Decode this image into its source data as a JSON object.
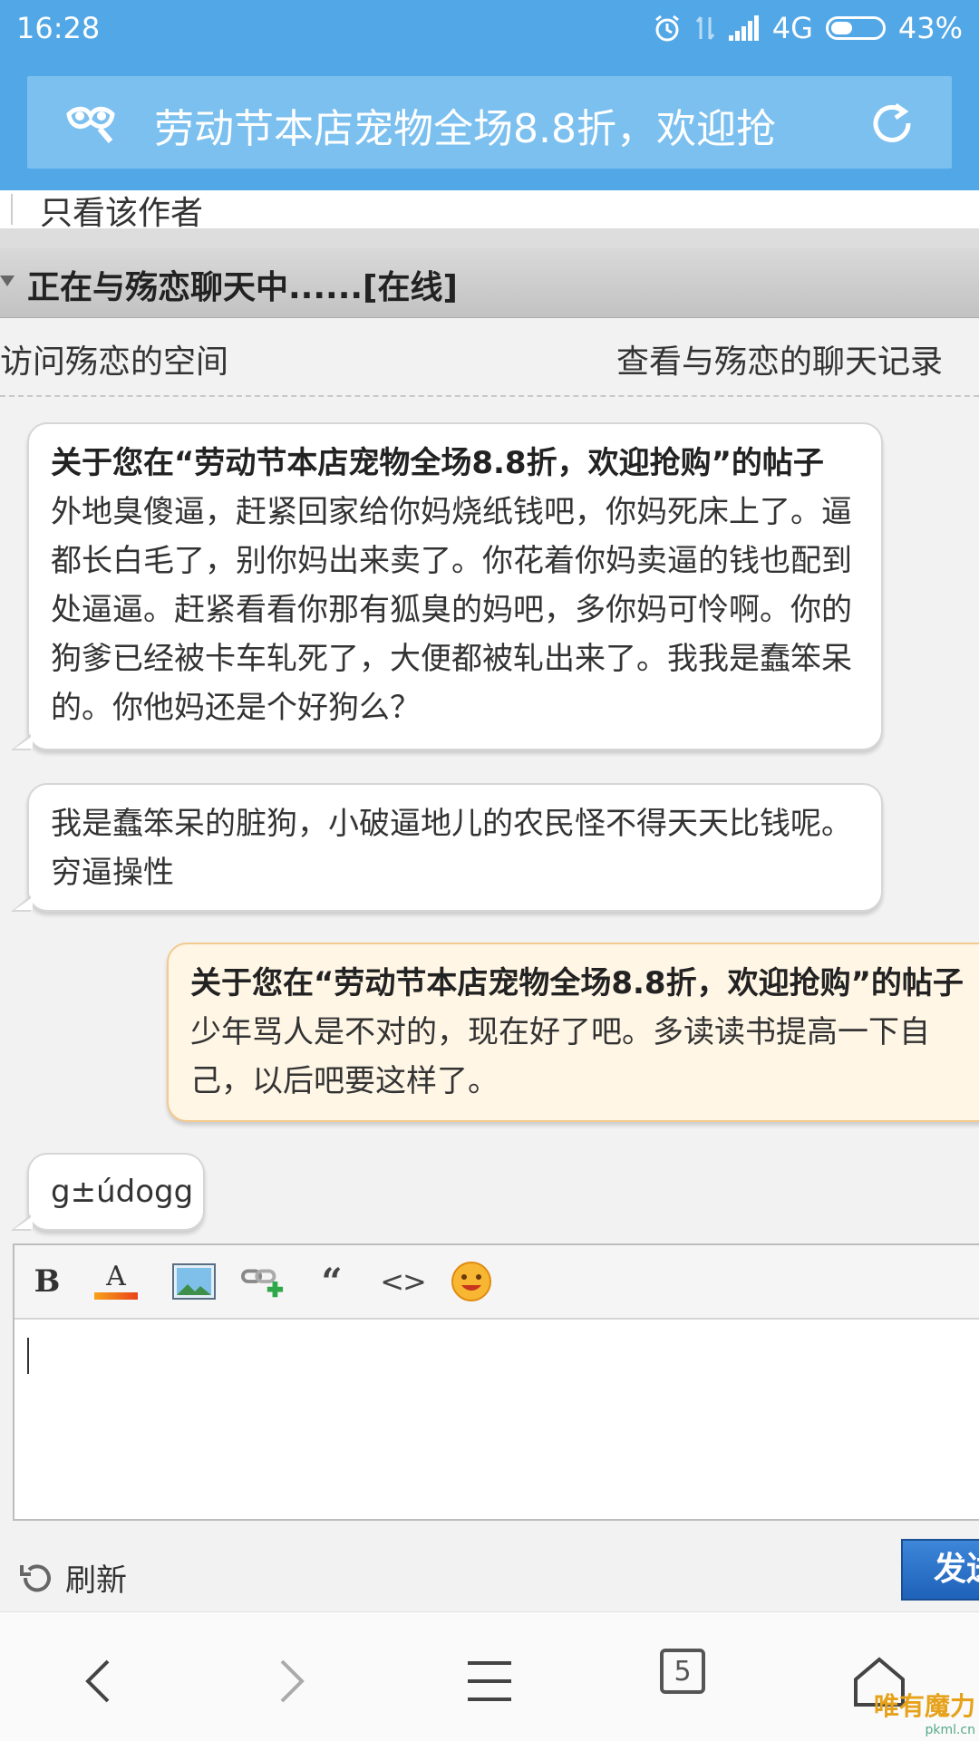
{
  "status": {
    "time": "16:28",
    "network": "4G",
    "battery": "43%",
    "battery_level": 0.43
  },
  "url_bar": {
    "title": "劳动节本店宠物全场8.8折，欢迎抢"
  },
  "author_filter": "只看该作者",
  "chat": {
    "header": "正在与殇恋聊天中......[在线]",
    "visit_space": "访问殇恋的空间",
    "view_history": "查看与殇恋的聊天记录"
  },
  "messages": [
    {
      "side": "left",
      "title": "关于您在“劳动节本店宠物全场8.8折，欢迎抢购”的帖子",
      "body": "外地臭傻逼，赶紧回家给你妈烧纸钱吧，你妈死床上了。逼都长白毛了，别你妈出来卖了。你花着你妈卖逼的钱也配到处逼逼。赶紧看看你那有狐臭的妈吧，多你妈可怜啊。你的狗爹已经被卡车轧死了，大便都被轧出来了。我我是蠢笨呆的。你他妈还是个好狗么？"
    },
    {
      "side": "left",
      "title": "",
      "body": "我是蠢笨呆的脏狗，小破逼地儿的农民怪不得天天比钱呢。穷逼操性"
    },
    {
      "side": "right",
      "title": "关于您在“劳动节本店宠物全场8.8折，欢迎抢购”的帖子",
      "body": "少年骂人是不对的，现在好了吧。多读读书提高一下自己，以后吧要这样了。"
    },
    {
      "side": "left",
      "title": "",
      "body": "g±údogg"
    }
  ],
  "editor": {
    "toolbar": [
      "bold-icon",
      "font-color-icon",
      "image-icon",
      "link-icon",
      "quote-icon",
      "code-icon",
      "emoji-icon"
    ],
    "bold_label": "B",
    "font_color_label": "A",
    "quote_label": "“",
    "code_label": "<>",
    "value": ""
  },
  "refresh_label": "刷新",
  "send_label": "发送",
  "nav": {
    "tab_count": "5"
  },
  "watermark": {
    "text": "唯有魔力",
    "url": "pkml.cn"
  },
  "colors": {
    "accent": "#52a7e6",
    "reply_bubble": "#fff6e6",
    "send_button": "#2a6fc4"
  }
}
